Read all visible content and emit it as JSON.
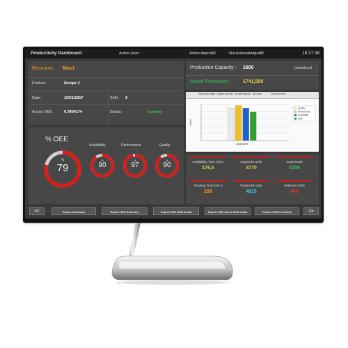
{
  "header": {
    "title": "Productivity Dashboard",
    "active_user_label": "Active User:",
    "active_alarms_label": "Active Alarms:",
    "active_alarms_value": "32",
    "not_ack_label": "Not Acknowledged:",
    "not_ack_value": "32",
    "time": "18:17:38"
  },
  "info": {
    "resource_label": "Resource:",
    "resource_value": "Mac1",
    "product_label": "Product:",
    "product_value": "Recipe 2",
    "date_label": "Date:",
    "date_value": "19/01/2017",
    "shift_label": "Shift:",
    "shift_value": "2",
    "actual_oee_label": "Actual OEE:",
    "actual_oee_value": "0,7854174",
    "status_label": "Status:",
    "status_value": "RUNNING"
  },
  "oee": {
    "title": "% OEE",
    "main_value": "79",
    "main_fraction": 0.79,
    "gauges": [
      {
        "label": "Availability",
        "value": "90",
        "fraction": 0.9
      },
      {
        "label": "Performance",
        "value": "97",
        "fraction": 0.97
      },
      {
        "label": "Quality",
        "value": "90",
        "fraction": 0.9
      }
    ],
    "pct_symbol": "%"
  },
  "capacity": {
    "label": "Production Capacity :",
    "value": "1800",
    "unit": "(units/hour)",
    "actual_label": "Actual Production:",
    "actual_value": "1741,509"
  },
  "chart_toolbar": [
    "Show data table",
    "Legend and title",
    "Simple Regular",
    "3D Style",
    "Zoom percent"
  ],
  "chart_data": {
    "type": "bar",
    "categories": [
      "Argument"
    ],
    "series": [
      {
        "name": "Quality",
        "values": [
          90
        ],
        "color": "#e8e8e8"
      },
      {
        "name": "Performance",
        "values": [
          97
        ],
        "color": "#f0c020"
      },
      {
        "name": "Availability",
        "values": [
          90
        ],
        "color": "#2060c8"
      },
      {
        "name": "OEE",
        "values": [
          79
        ],
        "color": "#30a030"
      }
    ],
    "xlabel": "Argument",
    "ylabel": "Value",
    "ylim": [
      0,
      100
    ],
    "legend": "right"
  },
  "stats": [
    {
      "label": "Availability Time (min.)",
      "value": "176,5",
      "color": "#e8d040"
    },
    {
      "label": "Expected Units",
      "value": "4770",
      "color": "#e8d040"
    },
    {
      "label": "Good Units",
      "value": "4159",
      "color": "#38c060"
    },
    {
      "label": "Running Time (min.)",
      "value": "159",
      "color": "#f0a020"
    },
    {
      "label": "Produced Units",
      "value": "4615",
      "color": "#38c8e8"
    },
    {
      "label": "Rejected Units",
      "value": "456",
      "color": "#e83030"
    }
  ],
  "nav": {
    "prev": "<<",
    "next": ">>",
    "buttons": [
      "Report Summary",
      "Report OEE Summary",
      "Report OEE Shift Detail",
      "Report OEE Lot In Shift Detail",
      "Report OEE Lot Detail"
    ]
  }
}
